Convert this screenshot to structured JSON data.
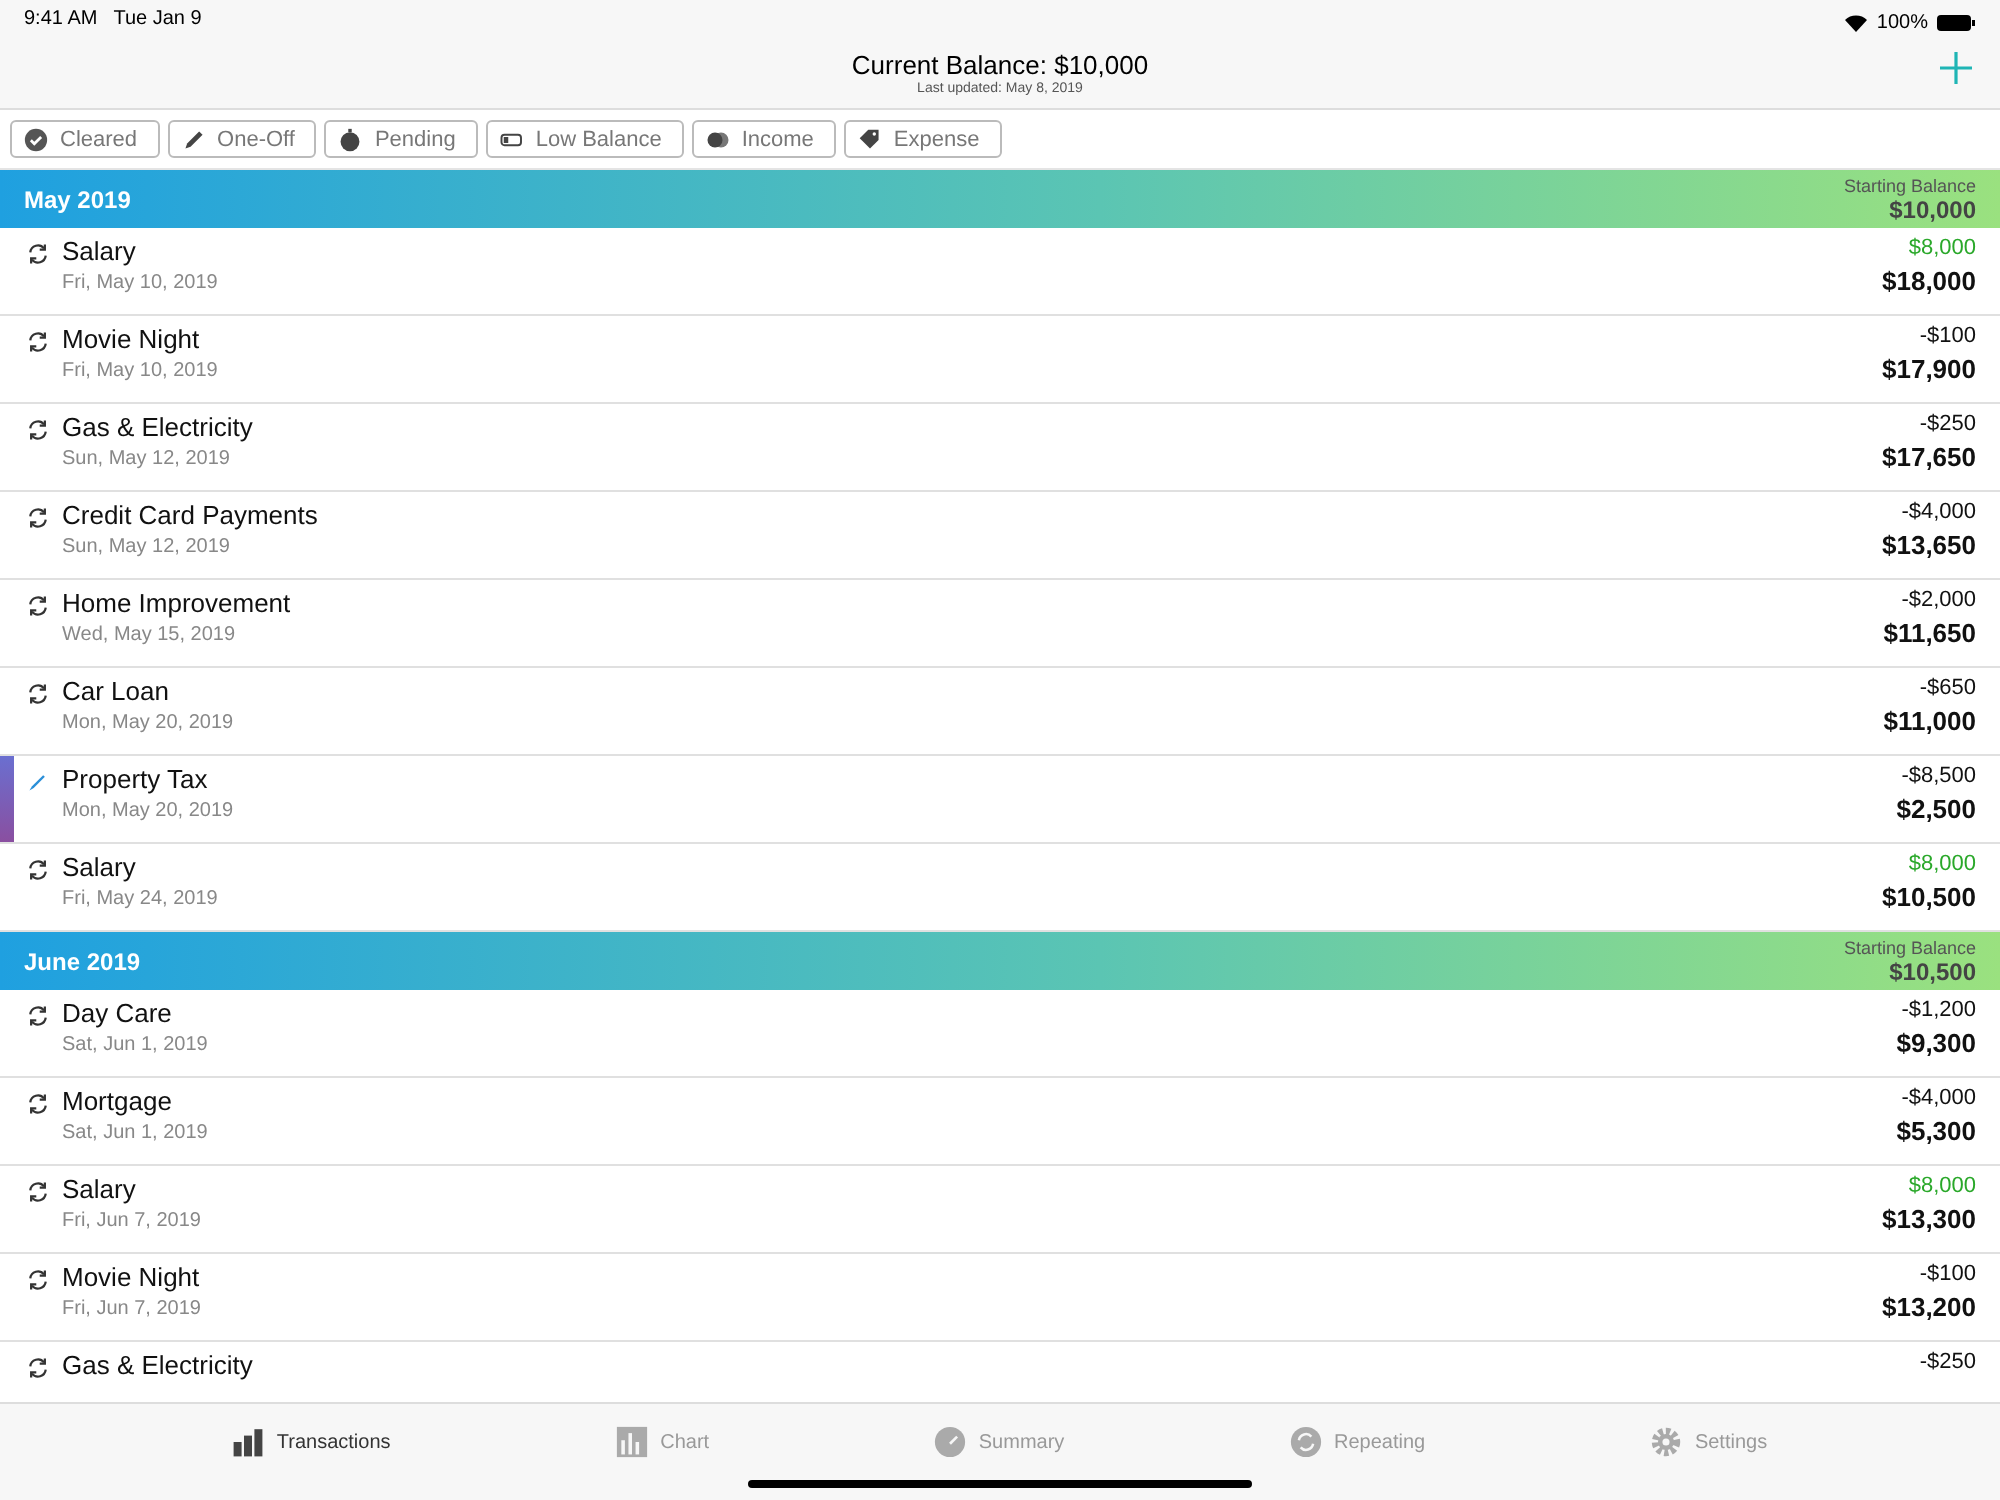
{
  "status_bar": {
    "time": "9:41 AM",
    "date": "Tue Jan 9",
    "battery": "100%"
  },
  "header": {
    "title": "Current Balance: $10,000",
    "subtitle": "Last updated: May 8, 2019"
  },
  "filters": [
    {
      "kind": "cleared",
      "label": "Cleared"
    },
    {
      "kind": "one-off",
      "label": "One-Off"
    },
    {
      "kind": "pending",
      "label": "Pending"
    },
    {
      "kind": "low-balance",
      "label": "Low Balance"
    },
    {
      "kind": "income",
      "label": "Income"
    },
    {
      "kind": "expense",
      "label": "Expense"
    }
  ],
  "sections": [
    {
      "title": "May 2019",
      "starting_label": "Starting Balance",
      "starting_balance": "$10,000",
      "rows": [
        {
          "kind": "repeating",
          "income": true,
          "name": "Salary",
          "date": "Fri, May 10, 2019",
          "amount": "$8,000",
          "balance": "$18,000"
        },
        {
          "kind": "repeating",
          "income": false,
          "name": "Movie Night",
          "date": "Fri, May 10, 2019",
          "amount": "-$100",
          "balance": "$17,900"
        },
        {
          "kind": "repeating",
          "income": false,
          "name": "Gas & Electricity",
          "date": "Sun, May 12, 2019",
          "amount": "-$250",
          "balance": "$17,650"
        },
        {
          "kind": "repeating",
          "income": false,
          "name": "Credit Card Payments",
          "date": "Sun, May 12, 2019",
          "amount": "-$4,000",
          "balance": "$13,650"
        },
        {
          "kind": "repeating",
          "income": false,
          "name": "Home Improvement",
          "date": "Wed, May 15, 2019",
          "amount": "-$2,000",
          "balance": "$11,650"
        },
        {
          "kind": "repeating",
          "income": false,
          "name": "Car Loan",
          "date": "Mon, May 20, 2019",
          "amount": "-$650",
          "balance": "$11,000"
        },
        {
          "kind": "one-off",
          "income": false,
          "name": "Property Tax",
          "date": "Mon, May 20, 2019",
          "amount": "-$8,500",
          "balance": "$2,500"
        },
        {
          "kind": "repeating",
          "income": true,
          "name": "Salary",
          "date": "Fri, May 24, 2019",
          "amount": "$8,000",
          "balance": "$10,500"
        }
      ]
    },
    {
      "title": "June 2019",
      "starting_label": "Starting Balance",
      "starting_balance": "$10,500",
      "rows": [
        {
          "kind": "repeating",
          "income": false,
          "name": "Day Care",
          "date": "Sat, Jun 1, 2019",
          "amount": "-$1,200",
          "balance": "$9,300"
        },
        {
          "kind": "repeating",
          "income": false,
          "name": "Mortgage",
          "date": "Sat, Jun 1, 2019",
          "amount": "-$4,000",
          "balance": "$5,300"
        },
        {
          "kind": "repeating",
          "income": true,
          "name": "Salary",
          "date": "Fri, Jun 7, 2019",
          "amount": "$8,000",
          "balance": "$13,300"
        },
        {
          "kind": "repeating",
          "income": false,
          "name": "Movie Night",
          "date": "Fri, Jun 7, 2019",
          "amount": "-$100",
          "balance": "$13,200"
        },
        {
          "kind": "repeating",
          "income": false,
          "name": "Gas & Electricity",
          "amount": "-$250"
        }
      ]
    }
  ],
  "tab_bar": [
    {
      "kind": "transactions",
      "label": "Transactions",
      "selected": true
    },
    {
      "kind": "chart",
      "label": "Chart",
      "selected": false
    },
    {
      "kind": "summary",
      "label": "Summary",
      "selected": false
    },
    {
      "kind": "repeating",
      "label": "Repeating",
      "selected": false
    },
    {
      "kind": "settings",
      "label": "Settings",
      "selected": false
    }
  ]
}
